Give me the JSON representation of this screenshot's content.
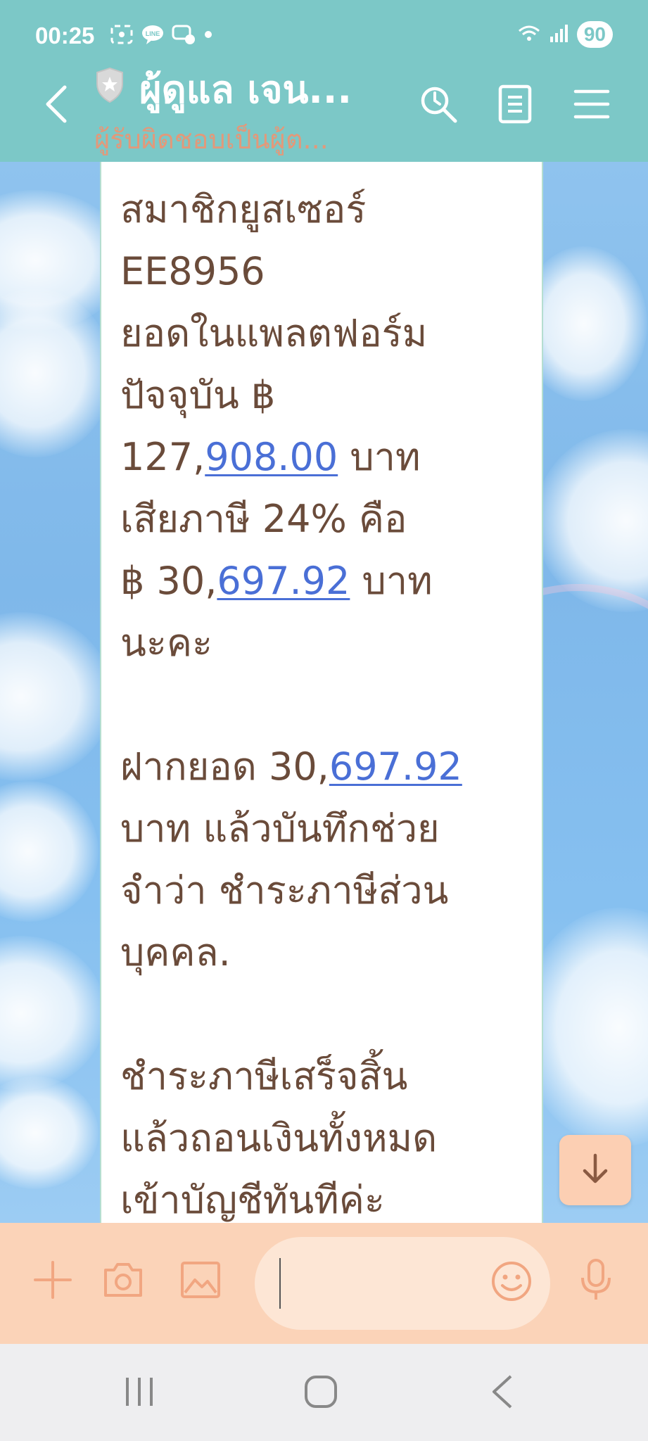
{
  "status_bar": {
    "time": "00:25",
    "battery": "90"
  },
  "header": {
    "title": "ผู้ดูแล เจน...",
    "subtitle": "ผู้รับผิดชอบเป็นผู้ต..."
  },
  "message": {
    "lines": [
      {
        "a": "สมาชิกยูสเซอร์"
      },
      {
        "a": " EE8956"
      },
      {
        "a": "ยอดในแพลตฟอร์ม"
      },
      {
        "a": "ปัจจุบัน ฿"
      },
      {
        "a": "127,",
        "link": "908.00",
        "b": " บาท"
      },
      {
        "a": "เสียภาษี  24%  คือ"
      },
      {
        "a": "฿ 30,",
        "link": "697.92",
        "b": " บาท"
      },
      {
        "a": "นะคะ"
      },
      {
        "a": ""
      },
      {
        "a": "ฝากยอด 30,",
        "link": "697.92",
        "b": ""
      },
      {
        "a": "บาท แล้วบันทึกช่วย"
      },
      {
        "a": "จำว่า ชำระภาษีส่วน"
      },
      {
        "a": "บุคคล."
      },
      {
        "a": ""
      },
      {
        "a": "ชำระภาษีเสร็จสิ้น"
      },
      {
        "a": "แล้วถอนเงินทั้งหมด"
      },
      {
        "a": "เข้าบัญชีทันทีค่ะ"
      }
    ]
  },
  "icons": {
    "back": "chevron-left-icon",
    "search": "search-icon",
    "notes": "notes-icon",
    "menu": "menu-icon",
    "scroll_down": "arrow-down-icon",
    "add": "plus-icon",
    "camera": "camera-icon",
    "gallery": "image-icon",
    "emoji": "emoji-icon",
    "mic": "microphone-icon"
  },
  "colors": {
    "header_bg": "#7cc8c7",
    "subtitle": "#ee9472",
    "message_text": "#6a4b3a",
    "link": "#4a6fd6",
    "input_bar_bg": "#fbd3b8",
    "input_field_bg": "#fde6d5"
  }
}
